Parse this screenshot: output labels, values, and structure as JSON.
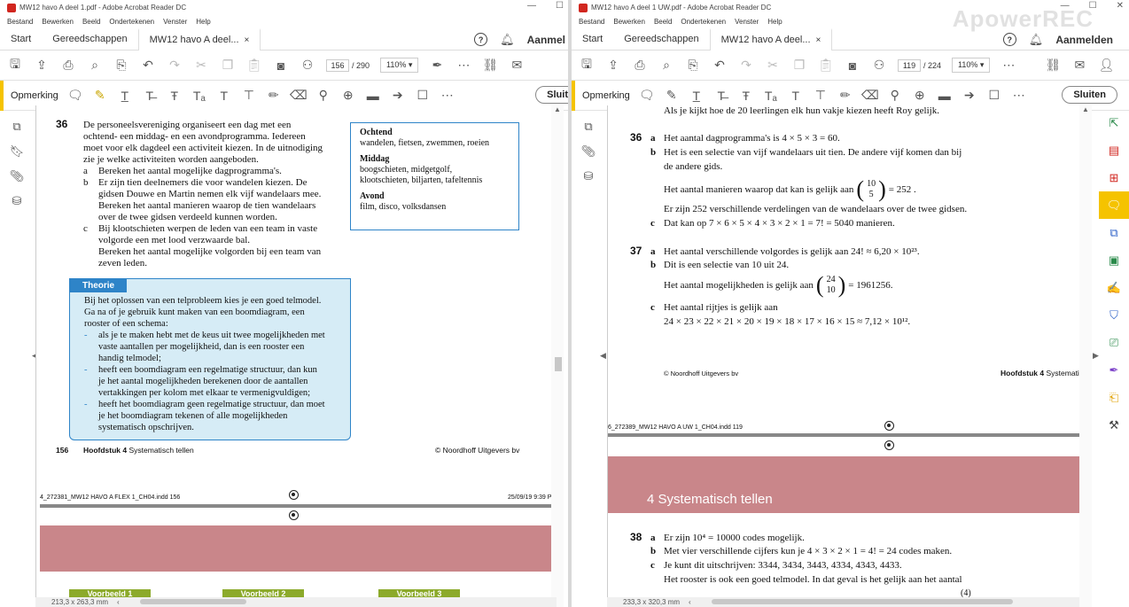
{
  "left": {
    "title": "MW12 havo A deel 1.pdf - Adobe Acrobat Reader DC",
    "menu": [
      "Bestand",
      "Bewerken",
      "Beeld",
      "Ondertekenen",
      "Venster",
      "Help"
    ],
    "tabs": {
      "start": "Start",
      "tools": "Gereedschappen",
      "doc": "MW12 havo A deel...",
      "close": "×"
    },
    "signin": "Aanmel",
    "page_current": "156",
    "page_total": "/ 290",
    "zoom": "110%",
    "comment_label": "Opmerking",
    "close_btn": "Sluit",
    "q36_num": "36",
    "q36_intro": [
      "De personeelsvereniging organiseert een dag met een",
      "ochtend- een middag- en een avondprogramma. Iedereen",
      "moet voor elk dagdeel een activiteit kiezen. In de uitnodiging",
      "zie je welke activiteiten worden aangeboden."
    ],
    "q36_a_label": "a",
    "q36_a": "Bereken het aantal mogelijke dagprogramma's.",
    "q36_b_label": "b",
    "q36_b": [
      "Er zijn tien deelnemers die voor wandelen kiezen. De",
      "gidsen Douwe en Martin nemen elk vijf wandelaars mee.",
      "Bereken het aantal manieren waarop de tien wandelaars",
      "over de twee gidsen verdeeld kunnen worden."
    ],
    "q36_c_label": "c",
    "q36_c": [
      "Bij klootschieten werpen de leden van een team in vaste",
      "volgorde een met lood verzwaarde bal.",
      "Bereken het aantal mogelijke volgorden bij een team van",
      "zeven leden."
    ],
    "box": {
      "h1": "Ochtend",
      "t1": "wandelen, fietsen, zwemmen, roeien",
      "h2": "Middag",
      "t2a": "boogschieten, midgetgolf,",
      "t2b": "klootschieten, biljarten, tafeltennis",
      "h3": "Avond",
      "t3": "film, disco, volksdansen"
    },
    "theory_title": "Theorie",
    "theory_lines": [
      "Bij het oplossen van een telprobleem kies je een goed telmodel.",
      "Ga na of je gebruik kunt maken van een boomdiagram, een",
      "rooster of een schema:"
    ],
    "theory_bullets": [
      [
        "als je te maken hebt met de keus uit twee mogelijkheden met",
        "vaste aantallen per mogelijkheid, dan is een rooster een",
        "handig telmodel;"
      ],
      [
        "heeft een boomdiagram een regelmatige structuur, dan kun",
        "je het aantal mogelijkheden berekenen door de aantallen",
        "vertakkingen per kolom met elkaar te vermenigvuldigen;"
      ],
      [
        "heeft het boomdiagram geen regelmatige structuur, dan moet",
        "je het boomdiagram tekenen of alle mogelijkheden",
        "systematisch opschrijven."
      ]
    ],
    "footer_page": "156",
    "footer_chapter_bold": "Hoofdstuk 4",
    "footer_chapter": "Systematisch tellen",
    "footer_copy": "© Noordhoff Uitgevers bv",
    "slug_left": "4_272381_MW12 HAVO A FLEX 1_CH04.indd   156",
    "slug_right": "25/09/19   9:39 P",
    "green": [
      "Voorbeeld 1",
      "Voorbeeld 2",
      "Voorbeeld 3"
    ],
    "status": "213,3 x 263,3 mm"
  },
  "right": {
    "title": "MW12 havo A deel 1 UW.pdf - Adobe Acrobat Reader DC",
    "menu": [
      "Bestand",
      "Bewerken",
      "Beeld",
      "Ondertekenen",
      "Venster",
      "Help"
    ],
    "tabs": {
      "start": "Start",
      "tools": "Gereedschappen",
      "doc": "MW12 havo A deel...",
      "close": "×"
    },
    "signin": "Aanmelden",
    "page_current": "119",
    "page_total": "/ 224",
    "zoom": "110%",
    "comment_label": "Opmerking",
    "close_btn": "Sluiten",
    "top_line": "Als je kijkt hoe de 20 leerlingen elk hun vakje kiezen heeft Roy gelijk.",
    "a36_num": "36",
    "a36_a_label": "a",
    "a36_a": "Het aantal dagprogramma's is 4 × 5 × 3 = 60.",
    "a36_b_label": "b",
    "a36_b1": "Het is een selectie van vijf wandelaars uit tien. De andere vijf komen dan bij",
    "a36_b2": "de andere gids.",
    "a36_b3_pre": "Het aantal manieren waarop dat kan is gelijk aan",
    "a36_b3_top": "10",
    "a36_b3_bot": "5",
    "a36_b3_post": "= 252 .",
    "a36_b4": "Er zijn 252 verschillende verdelingen van de wandelaars over de twee gidsen.",
    "a36_c_label": "c",
    "a36_c": "Dat kan op 7 × 6 × 5 × 4 × 3 × 2 × 1 = 7! = 5040 manieren.",
    "a37_num": "37",
    "a37_a_label": "a",
    "a37_a": "Het aantal verschillende volgordes is gelijk aan 24! ≈ 6,20 × 10²³.",
    "a37_b_label": "b",
    "a37_b": "Dit is een selectie van 10 uit 24.",
    "a37_b2_pre": "Het aantal mogelijkheden is gelijk aan",
    "a37_b2_top": "24",
    "a37_b2_bot": "10",
    "a37_b2_post": "= 1961256.",
    "a37_c_label": "c",
    "a37_c1": "Het aantal rijtjes is gelijk aan",
    "a37_c2": "24 × 23 × 22 × 21 × 20 × 19 × 18 × 17 × 16 × 15 ≈ 7,12 × 10¹².",
    "footer_copy": "© Noordhoff Uitgevers bv",
    "footer_chapter_bold": "Hoofdstuk 4",
    "footer_chapter": "Systemati",
    "slug_left": "6_272389_MW12 HAVO A UW 1_CH04.indd   119",
    "chapter_heading": "4  Systematisch tellen",
    "a38_num": "38",
    "a38_a_label": "a",
    "a38_a": "Er zijn 10⁴ = 10000 codes mogelijk.",
    "a38_b_label": "b",
    "a38_b": "Met vier verschillende cijfers kun je 4 × 3 × 2 × 1 = 4! = 24 codes maken.",
    "a38_c_label": "c",
    "a38_c": "Je kunt dit uitschrijven: 3344, 3434, 3443, 4334, 4343, 4433.",
    "a38_c2": "Het rooster is ook een goed telmodel. In dat geval is het gelijk aan het aantal",
    "a38_c3": "(4)",
    "status": "233,3 x 320,3 mm"
  },
  "watermark": "ApowerREC",
  "colors": {
    "accent": "#f5c300",
    "theory_blue": "#2e84c8",
    "theory_bg": "#d6ecf6",
    "pink": "#c9868a",
    "green": "#8caa2b",
    "pdf_red": "#d1261f"
  }
}
